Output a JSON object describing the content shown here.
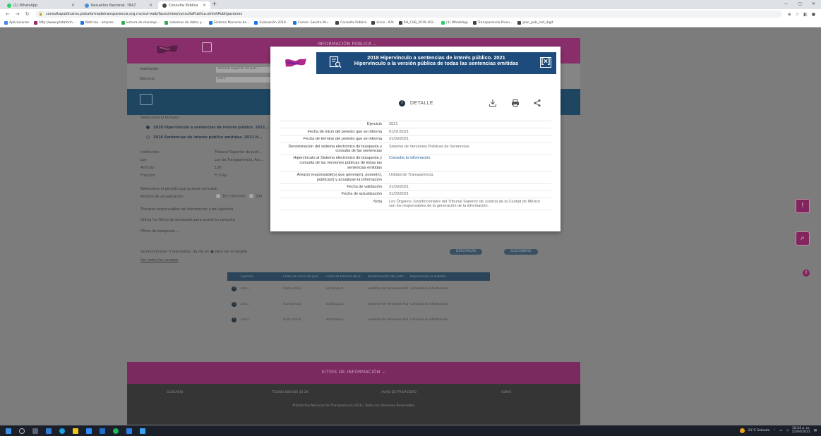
{
  "browser": {
    "tabs": [
      {
        "title": "(1) WhatsApp",
        "favicon_color": "#25d366"
      },
      {
        "title": "Resueltos Nacional: 7847",
        "favicon_color": "#4a90d9"
      },
      {
        "title": "Consulta Pública",
        "favicon_color": "#444444"
      }
    ],
    "new_tab": "+",
    "url": "consultapublicamx.plataformadetransparencia.org.mx/vut-web/faces/view/consultaPublica.xhtml#obligaciones",
    "bookmarks": [
      {
        "label": "Aplicaciones",
        "color": "#4285f4"
      },
      {
        "label": "http://www.plataform...",
        "color": "#8a2e6b"
      },
      {
        "label": "Noticias - empres...",
        "color": "#1a73e8"
      },
      {
        "label": "lectura de mensaje...",
        "color": "#34a853"
      },
      {
        "label": "sistemas de datos y...",
        "color": "#34a853"
      },
      {
        "label": "Sistema Nacional de...",
        "color": "#1a73e8"
      },
      {
        "label": "Evaluación 2019 -",
        "color": "#1a73e8"
      },
      {
        "label": "Correo: Sandra Mu...",
        "color": "#1a73e8"
      },
      {
        "label": "Consulta Pública",
        "color": "#444444"
      },
      {
        "label": "Inicio - IFAI",
        "color": "#444444"
      },
      {
        "label": "RH_CUB_2019-202...",
        "color": "#444444"
      },
      {
        "label": "(1) WhatsApp",
        "color": "#25d366"
      },
      {
        "label": "Transparencia Presu...",
        "color": "#444444"
      },
      {
        "label": "plan_pub_inst_digit",
        "color": "#444444"
      }
    ]
  },
  "page": {
    "header_title": "INFORMACIÓN PÚBLICA ⌄",
    "filters": [
      {
        "label": "Institución",
        "value": "Tribunal Superior de Just..."
      },
      {
        "label": "Ejercicio",
        "value": "2021"
      }
    ],
    "select_format": "Selecciona el formato",
    "format_options": [
      {
        "label": "2018 Hipervínculo a sentencias de interés público. 2021...",
        "selected": true
      },
      {
        "label": "2018 Sentencias de interés público emitidas. 2021 H...",
        "selected": false
      }
    ],
    "meta": [
      {
        "label": "Institución",
        "value": "Tribunal Superior de Justi..."
      },
      {
        "label": "Ley",
        "value": "Ley de Transparencia, Acc..."
      },
      {
        "label": "Artículo",
        "value": "126"
      },
      {
        "label": "Fracción",
        "value": "Fr II Ap"
      }
    ],
    "period_prompt": "Selecciona el periodo que quieres consultar",
    "period_label": "Periodo de actualización",
    "period_options": [
      "1er trimestre",
      "2do"
    ],
    "text_responsible": "Titulares responsables de información y del ejercicio",
    "text_use_fields": "Utiliza los filtros de búsqueda para acotar tu consulta",
    "search_filters": "Filtros de búsqueda ⌄",
    "results_text": "Se encontraron 3 resultados, da clic en ● para ver el detalle.",
    "see_all_fields": "Ver todos los campos",
    "btn_download": "DESCARGAR",
    "btn_subscribe": "SUSCRIBIRSE",
    "table": {
      "headers": [
        "Ejercicio",
        "Fecha de inicio del peri...",
        "Fecha de término del p...",
        "Denominación del siste...",
        "Hipervínculo al Sistema ..."
      ],
      "rows": [
        [
          "2021",
          "01/01/2021",
          "31/03/2021",
          "Sistema de Versiones Públi...",
          "Consulta la información"
        ],
        [
          "2021",
          "01/04/2021",
          "30/06/2021",
          "Sistema de Versiones Públi...",
          "Consulta la información"
        ],
        [
          "2021",
          "01/07/2021",
          "30/09/2021",
          "Sistema de Versiones Públi...",
          "Consulta la información"
        ]
      ]
    },
    "footer_title": "SITIOS DE INFORMACIÓN ⌄",
    "footer_items": [
      "GLOSARIO",
      "TELINAI 800 835 43 24",
      "AVISO DE PRIVACIDAD",
      "GUÍAS"
    ],
    "footer_copyright": "Plataforma Nacional de Transparencia 2018 | Todos los Derechos Reservados"
  },
  "modal": {
    "title": "2018 Hipervínculo a sentencias de interés público. 2021 Hipervínculo a la versión pública de todas las sentencias emitidas",
    "close": "[×]",
    "detail_label": "DETALLE",
    "fields": [
      {
        "label": "Ejercicio",
        "value": "2021",
        "link": false
      },
      {
        "label": "Fecha de inicio del periodo que se informa",
        "value": "01/01/2021",
        "link": false
      },
      {
        "label": "Fecha de término del periodo que se informa",
        "value": "31/03/2021",
        "link": false
      },
      {
        "label": "Denominación del sistema electrónico de búsqueda y consulta de las sentencias",
        "value": "Sistema de Versiones Públicas de Sentencias",
        "link": false
      },
      {
        "label": "Hipervínculo al Sistema electrónico de búsqueda y consulta de las versiones públicas de todas las sentencias emitidas",
        "value": "Consulta la información",
        "link": true
      },
      {
        "label": "Área(s) responsable(s) que genera(n), posee(n), publica(n) y actualizan la información",
        "value": "Unidad de Transparencia",
        "link": false
      },
      {
        "label": "Fecha de validación",
        "value": "31/03/2021",
        "link": false
      },
      {
        "label": "Fecha de actualización",
        "value": "31/03/2021",
        "link": false
      },
      {
        "label": "Nota",
        "value": "Los Órganos Jurisdiccionales del Tribunal Superior de Justicia de la Ciudad de México son los responsables de la generación de la información.",
        "link": false
      }
    ]
  },
  "taskbar": {
    "weather": "21°C Soleado",
    "time": "10:24 a. m.",
    "date": "21/04/2021"
  },
  "colors": {
    "brand_magenta": "#8a2e6b",
    "modal_header_blue": "#1d4b7c",
    "link_blue": "#1f5e96"
  }
}
